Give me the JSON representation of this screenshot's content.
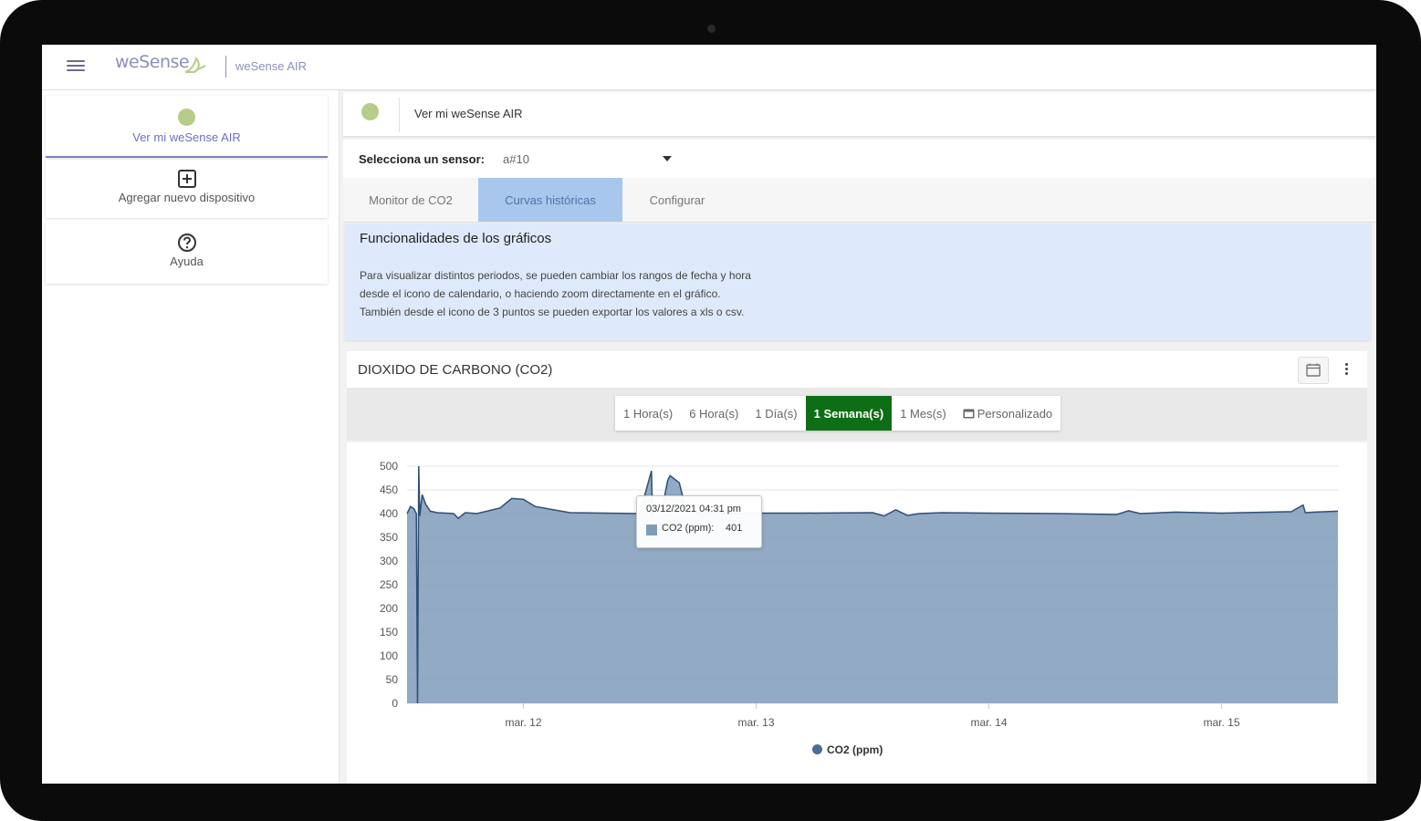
{
  "header": {
    "logo_text": "weSense",
    "app_name": "weSense AIR"
  },
  "sidebar": {
    "items": [
      {
        "label": "Ver mi weSense AIR",
        "icon": "status-dot-icon",
        "active": true
      },
      {
        "label": "Agregar nuevo dispositivo",
        "icon": "add-box-icon"
      },
      {
        "label": "Ayuda",
        "icon": "help-icon"
      }
    ]
  },
  "device": {
    "name": "Ver mi weSense AIR",
    "status_color": "#b6cc8a"
  },
  "sensor": {
    "label": "Selecciona un sensor:",
    "value": "a#10"
  },
  "tabs": [
    {
      "label": "Monitor de CO2"
    },
    {
      "label": "Curvas históricas",
      "active": true
    },
    {
      "label": "Configurar"
    }
  ],
  "info": {
    "title": "Funcionalidades de los gráficos",
    "lines": [
      "Para visualizar distintos periodos, se pueden cambiar los rangos de fecha y hora",
      "desde el icono de calendario, o haciendo zoom directamente en el gráfico.",
      "También desde el icono de 3 puntos se pueden exportar los valores a xls o csv."
    ]
  },
  "card": {
    "title": "DIOXIDO DE CARBONO (CO2)"
  },
  "ranges": [
    {
      "label": "1 Hora(s)"
    },
    {
      "label": "6 Hora(s)"
    },
    {
      "label": "1 Día(s)"
    },
    {
      "label": "1 Semana(s)",
      "active": true
    },
    {
      "label": "1 Mes(s)"
    },
    {
      "label": "Personalizado",
      "icon": "calendar-icon"
    }
  ],
  "tooltip": {
    "date": "03/12/2021 04:31 pm",
    "series": "CO2 (ppm):",
    "value": "401"
  },
  "colors": {
    "accent": "#7b7fbe",
    "active_range": "#0e6e16",
    "active_tab": "#a9c7ec",
    "info_bg": "#deeafb",
    "series_fill": "#7f9bb8",
    "series_line": "#2f4f74"
  },
  "chart_data": {
    "type": "area",
    "title": "",
    "xlabel": "",
    "ylabel": "",
    "ylim": [
      0,
      500
    ],
    "yticks": [
      0,
      50,
      100,
      150,
      200,
      250,
      300,
      350,
      400,
      450,
      500
    ],
    "xlim": [
      11.5,
      15.5
    ],
    "xticks": [
      {
        "value": 12,
        "label": "mar. 12"
      },
      {
        "value": 13,
        "label": "mar. 13"
      },
      {
        "value": 14,
        "label": "mar. 14"
      },
      {
        "value": 15,
        "label": "mar. 15"
      }
    ],
    "legend_position": "bottom",
    "grid": true,
    "series": [
      {
        "name": "CO2 (ppm)",
        "x": [
          11.5,
          11.515,
          11.53,
          11.54,
          11.545,
          11.55,
          11.555,
          11.565,
          11.58,
          11.6,
          11.63,
          11.7,
          11.72,
          11.75,
          11.8,
          11.9,
          11.95,
          12.0,
          12.05,
          12.2,
          12.5,
          12.55,
          12.555,
          12.56,
          12.6,
          12.62,
          12.63,
          12.67,
          12.7,
          12.75,
          12.9,
          13.2,
          13.5,
          13.55,
          13.6,
          13.65,
          13.7,
          13.8,
          14.0,
          14.3,
          14.55,
          14.6,
          14.65,
          14.8,
          15.0,
          15.3,
          15.35,
          15.36,
          15.4,
          15.5
        ],
        "y": [
          400,
          415,
          410,
          400,
          0,
          500,
          395,
          440,
          420,
          405,
          402,
          400,
          390,
          402,
          400,
          412,
          432,
          430,
          415,
          402,
          400,
          490,
          400,
          402,
          420,
          470,
          480,
          465,
          405,
          402,
          401,
          401,
          402,
          395,
          408,
          396,
          400,
          402,
          401,
          400,
          398,
          406,
          400,
          403,
          401,
          404,
          418,
          402,
          403,
          405
        ]
      }
    ]
  }
}
